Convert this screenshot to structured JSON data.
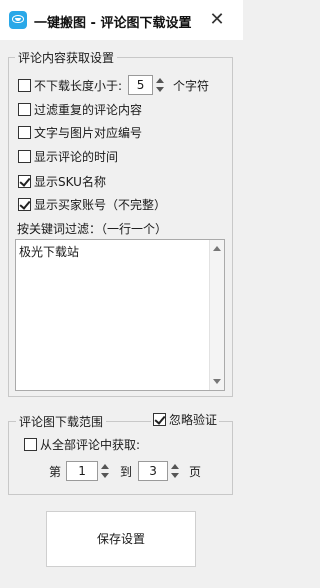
{
  "window": {
    "title": "一键搬图 - 评论图下载设置",
    "close_glyph": "✕"
  },
  "fetch_settings": {
    "legend": "评论内容获取设置",
    "length_filter": {
      "label": "不下载长度小于:",
      "value": "5",
      "unit": "个字符",
      "checked": false
    },
    "options": [
      {
        "label": "过滤重复的评论内容",
        "checked": false
      },
      {
        "label": "文字与图片对应编号",
        "checked": false
      },
      {
        "label": "显示评论的时间",
        "checked": false
      },
      {
        "label": "显示SKU名称",
        "checked": true
      },
      {
        "label": "显示买家账号（不完整）",
        "checked": true
      }
    ],
    "keyword_label": "按关键词过滤：（一行一个）",
    "keywords": "极光下载站"
  },
  "range_settings": {
    "legend": "评论图下载范围",
    "ignore_verify": {
      "label": "忽略验证",
      "checked": true
    },
    "fetch_all": {
      "label": "从全部评论中获取:",
      "checked": false
    },
    "page_from_label": "第",
    "page_from": "1",
    "page_to_label": "到",
    "page_to": "3",
    "page_unit": "页"
  },
  "save_button": {
    "label": "保存设置"
  }
}
